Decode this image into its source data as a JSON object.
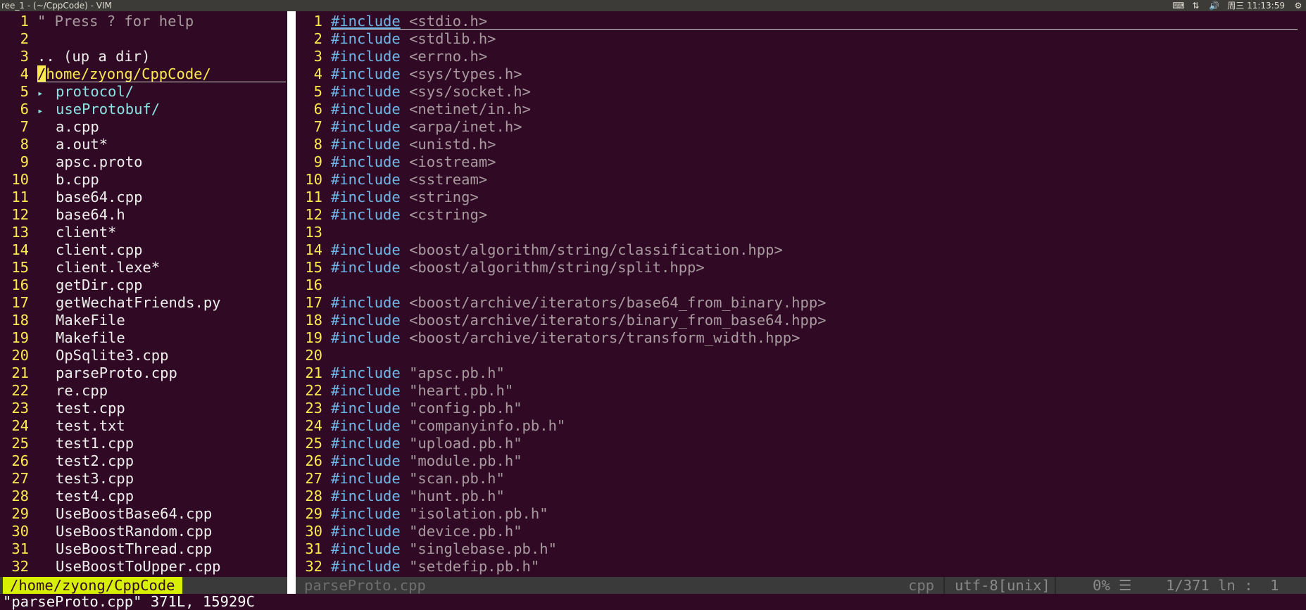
{
  "topbar": {
    "title": "ree_1 - (~/CppCode) - VIM",
    "keyboard_icon": "keyboard-icon",
    "network_icon": "network-icon",
    "volume_icon": "volume-icon",
    "clock": "周三 11:13:59",
    "settings_icon": "gear-icon"
  },
  "tree": {
    "lines": [
      {
        "n": "1",
        "text": "\" Press ? for help",
        "kind": "comment"
      },
      {
        "n": "2",
        "text": "",
        "kind": "blank"
      },
      {
        "n": "3",
        "text": ".. (up a dir)",
        "kind": "updir"
      },
      {
        "n": "4",
        "text": "/home/zyong/CppCode/",
        "kind": "root"
      },
      {
        "n": "5",
        "text": "protocol/",
        "kind": "dir"
      },
      {
        "n": "6",
        "text": "useProtobuf/",
        "kind": "dir"
      },
      {
        "n": "7",
        "text": "a.cpp",
        "kind": "file"
      },
      {
        "n": "8",
        "text": "a.out*",
        "kind": "file"
      },
      {
        "n": "9",
        "text": "apsc.proto",
        "kind": "file"
      },
      {
        "n": "10",
        "text": "b.cpp",
        "kind": "file"
      },
      {
        "n": "11",
        "text": "base64.cpp",
        "kind": "file"
      },
      {
        "n": "12",
        "text": "base64.h",
        "kind": "file"
      },
      {
        "n": "13",
        "text": "client*",
        "kind": "file"
      },
      {
        "n": "14",
        "text": "client.cpp",
        "kind": "file"
      },
      {
        "n": "15",
        "text": "client.lexe*",
        "kind": "file"
      },
      {
        "n": "16",
        "text": "getDir.cpp",
        "kind": "file"
      },
      {
        "n": "17",
        "text": "getWechatFriends.py",
        "kind": "file"
      },
      {
        "n": "18",
        "text": "MakeFile",
        "kind": "file"
      },
      {
        "n": "19",
        "text": "Makefile",
        "kind": "file"
      },
      {
        "n": "20",
        "text": "OpSqlite3.cpp",
        "kind": "file"
      },
      {
        "n": "21",
        "text": "parseProto.cpp",
        "kind": "file"
      },
      {
        "n": "22",
        "text": "re.cpp",
        "kind": "file"
      },
      {
        "n": "23",
        "text": "test.cpp",
        "kind": "file"
      },
      {
        "n": "24",
        "text": "test.txt",
        "kind": "file"
      },
      {
        "n": "25",
        "text": "test1.cpp",
        "kind": "file"
      },
      {
        "n": "26",
        "text": "test2.cpp",
        "kind": "file"
      },
      {
        "n": "27",
        "text": "test3.cpp",
        "kind": "file"
      },
      {
        "n": "28",
        "text": "test4.cpp",
        "kind": "file"
      },
      {
        "n": "29",
        "text": "UseBoostBase64.cpp",
        "kind": "file"
      },
      {
        "n": "30",
        "text": "UseBoostRandom.cpp",
        "kind": "file"
      },
      {
        "n": "31",
        "text": "UseBoostThread.cpp",
        "kind": "file"
      },
      {
        "n": "32",
        "text": "UseBoostToUpper.cpp",
        "kind": "file"
      }
    ],
    "status_dir": "/home/zyong/CppCode"
  },
  "editor": {
    "lines": [
      {
        "n": "1",
        "kw": "#include",
        "arg": "<stdio.h>"
      },
      {
        "n": "2",
        "kw": "#include",
        "arg": "<stdlib.h>"
      },
      {
        "n": "3",
        "kw": "#include",
        "arg": "<errno.h>"
      },
      {
        "n": "4",
        "kw": "#include",
        "arg": "<sys/types.h>"
      },
      {
        "n": "5",
        "kw": "#include",
        "arg": "<sys/socket.h>"
      },
      {
        "n": "6",
        "kw": "#include",
        "arg": "<netinet/in.h>"
      },
      {
        "n": "7",
        "kw": "#include",
        "arg": "<arpa/inet.h>"
      },
      {
        "n": "8",
        "kw": "#include",
        "arg": "<unistd.h>"
      },
      {
        "n": "9",
        "kw": "#include",
        "arg": "<iostream>"
      },
      {
        "n": "10",
        "kw": "#include",
        "arg": "<sstream>"
      },
      {
        "n": "11",
        "kw": "#include",
        "arg": "<string>"
      },
      {
        "n": "12",
        "kw": "#include",
        "arg": "<cstring>"
      },
      {
        "n": "13",
        "kw": "",
        "arg": ""
      },
      {
        "n": "14",
        "kw": "#include",
        "arg": "<boost/algorithm/string/classification.hpp>"
      },
      {
        "n": "15",
        "kw": "#include",
        "arg": "<boost/algorithm/string/split.hpp>"
      },
      {
        "n": "16",
        "kw": "",
        "arg": ""
      },
      {
        "n": "17",
        "kw": "#include",
        "arg": "<boost/archive/iterators/base64_from_binary.hpp>"
      },
      {
        "n": "18",
        "kw": "#include",
        "arg": "<boost/archive/iterators/binary_from_base64.hpp>"
      },
      {
        "n": "19",
        "kw": "#include",
        "arg": "<boost/archive/iterators/transform_width.hpp>"
      },
      {
        "n": "20",
        "kw": "",
        "arg": ""
      },
      {
        "n": "21",
        "kw": "#include",
        "arg": "\"apsc.pb.h\""
      },
      {
        "n": "22",
        "kw": "#include",
        "arg": "\"heart.pb.h\""
      },
      {
        "n": "23",
        "kw": "#include",
        "arg": "\"config.pb.h\""
      },
      {
        "n": "24",
        "kw": "#include",
        "arg": "\"companyinfo.pb.h\""
      },
      {
        "n": "25",
        "kw": "#include",
        "arg": "\"upload.pb.h\""
      },
      {
        "n": "26",
        "kw": "#include",
        "arg": "\"module.pb.h\""
      },
      {
        "n": "27",
        "kw": "#include",
        "arg": "\"scan.pb.h\""
      },
      {
        "n": "28",
        "kw": "#include",
        "arg": "\"hunt.pb.h\""
      },
      {
        "n": "29",
        "kw": "#include",
        "arg": "\"isolation.pb.h\""
      },
      {
        "n": "30",
        "kw": "#include",
        "arg": "\"device.pb.h\""
      },
      {
        "n": "31",
        "kw": "#include",
        "arg": "\"singlebase.pb.h\""
      },
      {
        "n": "32",
        "kw": "#include",
        "arg": "\"setdefip.pb.h\""
      }
    ],
    "status": {
      "filename": "parseProto.cpp",
      "filetype": "cpp",
      "encoding": "utf-8[unix]",
      "percent": "0% ☰",
      "position": "1/371 ln :  1"
    }
  },
  "cmdline": "\"parseProto.cpp\" 371L, 15929C",
  "colors": {
    "background": "#300a24",
    "line_number": "#fce94f",
    "include_keyword": "#6fb7e8",
    "directory": "#8ae2e2",
    "status_dir_bg": "#d7f000"
  }
}
